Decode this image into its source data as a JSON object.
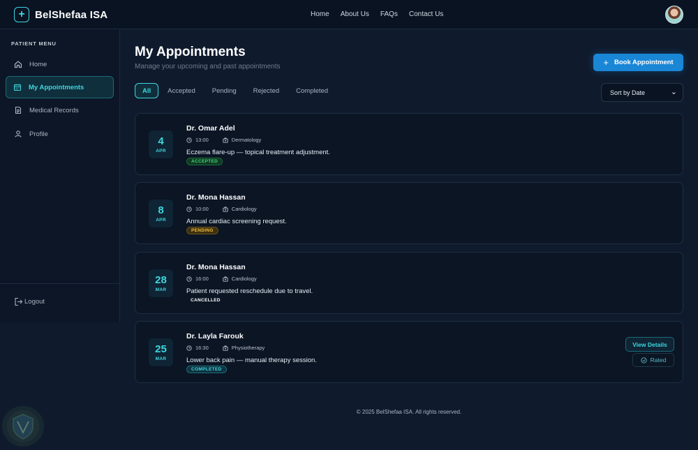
{
  "header": {
    "brand_icon": "+",
    "brand_name": "BelShefaa ISA",
    "nav": [
      "Home",
      "About Us",
      "FAQs",
      "Contact Us"
    ]
  },
  "sidebar": {
    "title": "PATIENT MENU",
    "items": [
      {
        "label": "Home",
        "icon": "home-icon"
      },
      {
        "label": "My Appointments",
        "icon": "calendar-icon"
      },
      {
        "label": "Medical Records",
        "icon": "document-icon"
      },
      {
        "label": "Profile",
        "icon": "user-icon"
      }
    ],
    "logout": "Logout"
  },
  "main": {
    "title": "My Appointments",
    "subtitle": "Manage your upcoming and past appointments",
    "book_button": "Book Appointment",
    "book_icon": "+",
    "tabs": [
      "All",
      "Accepted",
      "Pending",
      "Rejected",
      "Completed"
    ],
    "sort_label": "Sort by Date",
    "sort_caret": "⌄"
  },
  "appointments": [
    {
      "day": "4",
      "month": "APR",
      "doctor": "Dr. Omar Adel",
      "time": "13:00",
      "specialty": "Dermatology",
      "description": "Eczema flare-up — topical treatment adjustment.",
      "status": "ACCEPTED"
    },
    {
      "day": "8",
      "month": "APR",
      "doctor": "Dr. Mona Hassan",
      "time": "10:00",
      "specialty": "Cardiology",
      "description": "Annual cardiac screening request.",
      "status": "PENDING"
    },
    {
      "day": "28",
      "month": "MAR",
      "doctor": "Dr. Mona Hassan",
      "time": "16:00",
      "specialty": "Cardiology",
      "description": "Patient requested reschedule due to travel.",
      "status": "CANCELLED"
    },
    {
      "day": "25",
      "month": "MAR",
      "doctor": "Dr. Layla Farouk",
      "time": "16:30",
      "specialty": "Physiotherapy",
      "description": "Lower back pain — manual therapy session.",
      "status": "COMPLETED",
      "view_details": "View Details",
      "rated": "Rated"
    }
  ],
  "footer": "© 2025 BelShefaa ISA. All rights reserved.",
  "colors": {
    "accent": "#3fd6e0",
    "primary_button": "#1a86d6",
    "background": "#0f1b2d"
  }
}
